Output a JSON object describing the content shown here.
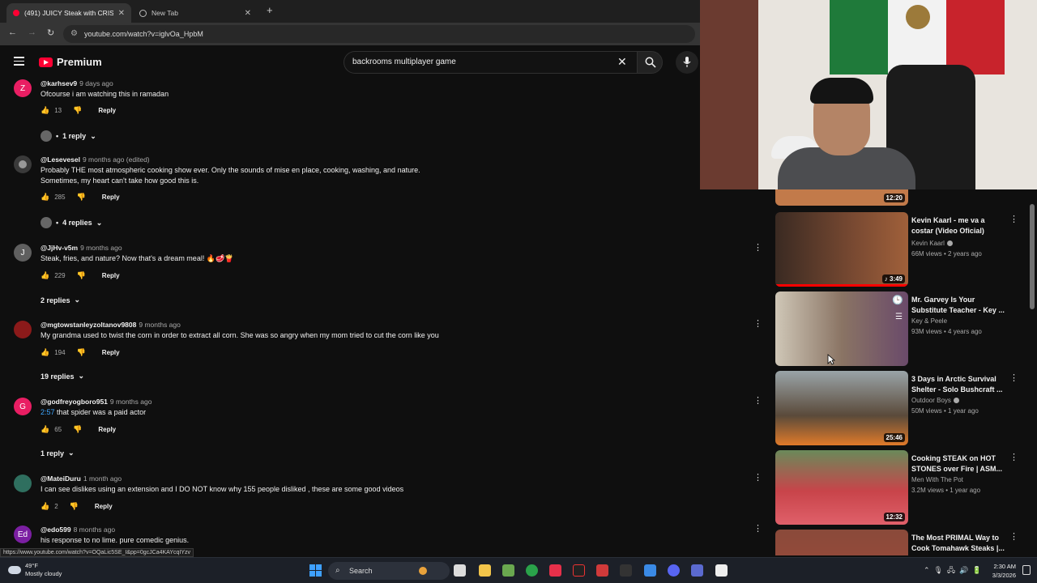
{
  "browser": {
    "active_tab_title": "(491) JUICY Steak with CRISPY FRIES",
    "inactive_tab_title": "New Tab",
    "url": "youtube.com/watch?v=iglvOa_HpbM"
  },
  "youtube": {
    "logo_text": "Premium",
    "search_query": "backrooms multiplayer game"
  },
  "comments": [
    {
      "handle": "@karhsev9",
      "time": "9 days ago",
      "text": "Ofcourse i am watching this in ramadan",
      "likes": "13",
      "reply": "Reply",
      "replies": "1 reply",
      "avatar": "Z",
      "avatar_color": "#e91e63"
    },
    {
      "handle": "@Lesevesel",
      "time": "9 months ago (edited)",
      "text": "Probably THE most atmospheric cooking show ever.  Only the sounds of mise en place, cooking, washing, and nature. Sometimes, my heart can't take how good this is.",
      "likes": "285",
      "reply": "Reply",
      "replies": "4 replies",
      "avatar": "",
      "avatar_color": "#3a3a3a"
    },
    {
      "handle": "@JjHv-v5m",
      "time": "9 months ago",
      "text": "Steak, fries, and nature? Now that's a dream meal! 🔥🥩🍟",
      "likes": "229",
      "reply": "Reply",
      "replies": "2 replies",
      "avatar": "J",
      "avatar_color": "#5f5f5f"
    },
    {
      "handle": "@mgtowstanleyzoltanov9808",
      "time": "9 months ago",
      "text": "My grandma used to twist the corn in order to extract all corn. She was so angry when my mom tried to cut the corn like you",
      "likes": "194",
      "reply": "Reply",
      "replies": "19 replies",
      "avatar": "",
      "avatar_color": "#8b1a1a"
    },
    {
      "handle": "@godfreyogboro951",
      "time": "9 months ago",
      "timestamp_link": "2:57",
      "text": " that spider was a paid actor",
      "likes": "65",
      "reply": "Reply",
      "replies": "1 reply",
      "avatar": "G",
      "avatar_color": "#e91e63"
    },
    {
      "handle": "@MateiDuru",
      "time": "1 month ago",
      "text": "I can see dislikes using an extension and I DO NOT  know why 155 people disliked , these are some good videos",
      "likes": "2",
      "reply": "Reply",
      "avatar": "",
      "avatar_color": "#2f6f5f"
    },
    {
      "handle": "@edo599",
      "time": "8 months ago",
      "text": "his response to no lime. pure comedic genius.",
      "avatar": "Ed",
      "avatar_color": "#7b1fa2"
    }
  ],
  "recommendations": [
    {
      "title": "",
      "channel": "",
      "meta": "",
      "duration": "12:20",
      "thumb_color": "#c27a4a"
    },
    {
      "title": "Kevin Kaarl - me va a costar (Video Oficial)",
      "channel": "Kevin Kaarl",
      "verified": true,
      "meta": "66M views • 2 years ago",
      "duration": "♪ 3:49",
      "thumb_color": "#5e3a2a",
      "progress": 1.0
    },
    {
      "title": "Mr. Garvey Is Your Substitute Teacher - Key ...",
      "channel": "Key & Peele",
      "verified": false,
      "meta": "93M views • 4 years ago",
      "duration": "",
      "thumb_color": "#7b6a58"
    },
    {
      "title": "3 Days in Arctic Survival Shelter - Solo Bushcraft ...",
      "channel": "Outdoor Boys",
      "verified": true,
      "meta": "50M views • 1 year ago",
      "duration": "25:46",
      "thumb_color": "#6b5a48"
    },
    {
      "title": "Cooking STEAK on HOT STONES over Fire | ASM...",
      "channel": "Men With The Pot",
      "verified": false,
      "meta": "3.2M views • 1 year ago",
      "duration": "12:32",
      "thumb_color": "#b8454a"
    },
    {
      "title": "The Most PRIMAL Way to Cook Tomahawk Steaks |...",
      "channel": "Men With The Pot",
      "verified": false,
      "meta": "",
      "duration": "",
      "thumb_color": "#a14a3a"
    }
  ],
  "status_url": "https://www.youtube.com/watch?v=OQaLic5SE_I&pp=0gcJCa4KAYcqIYzv",
  "taskbar": {
    "temp": "49°F",
    "weather": "Mostly cloudy",
    "search_label": "Search",
    "time": "2:30 AM",
    "date": "3/3/2026"
  },
  "colors": {
    "accent": "#ff0033",
    "link": "#3ea6ff"
  }
}
